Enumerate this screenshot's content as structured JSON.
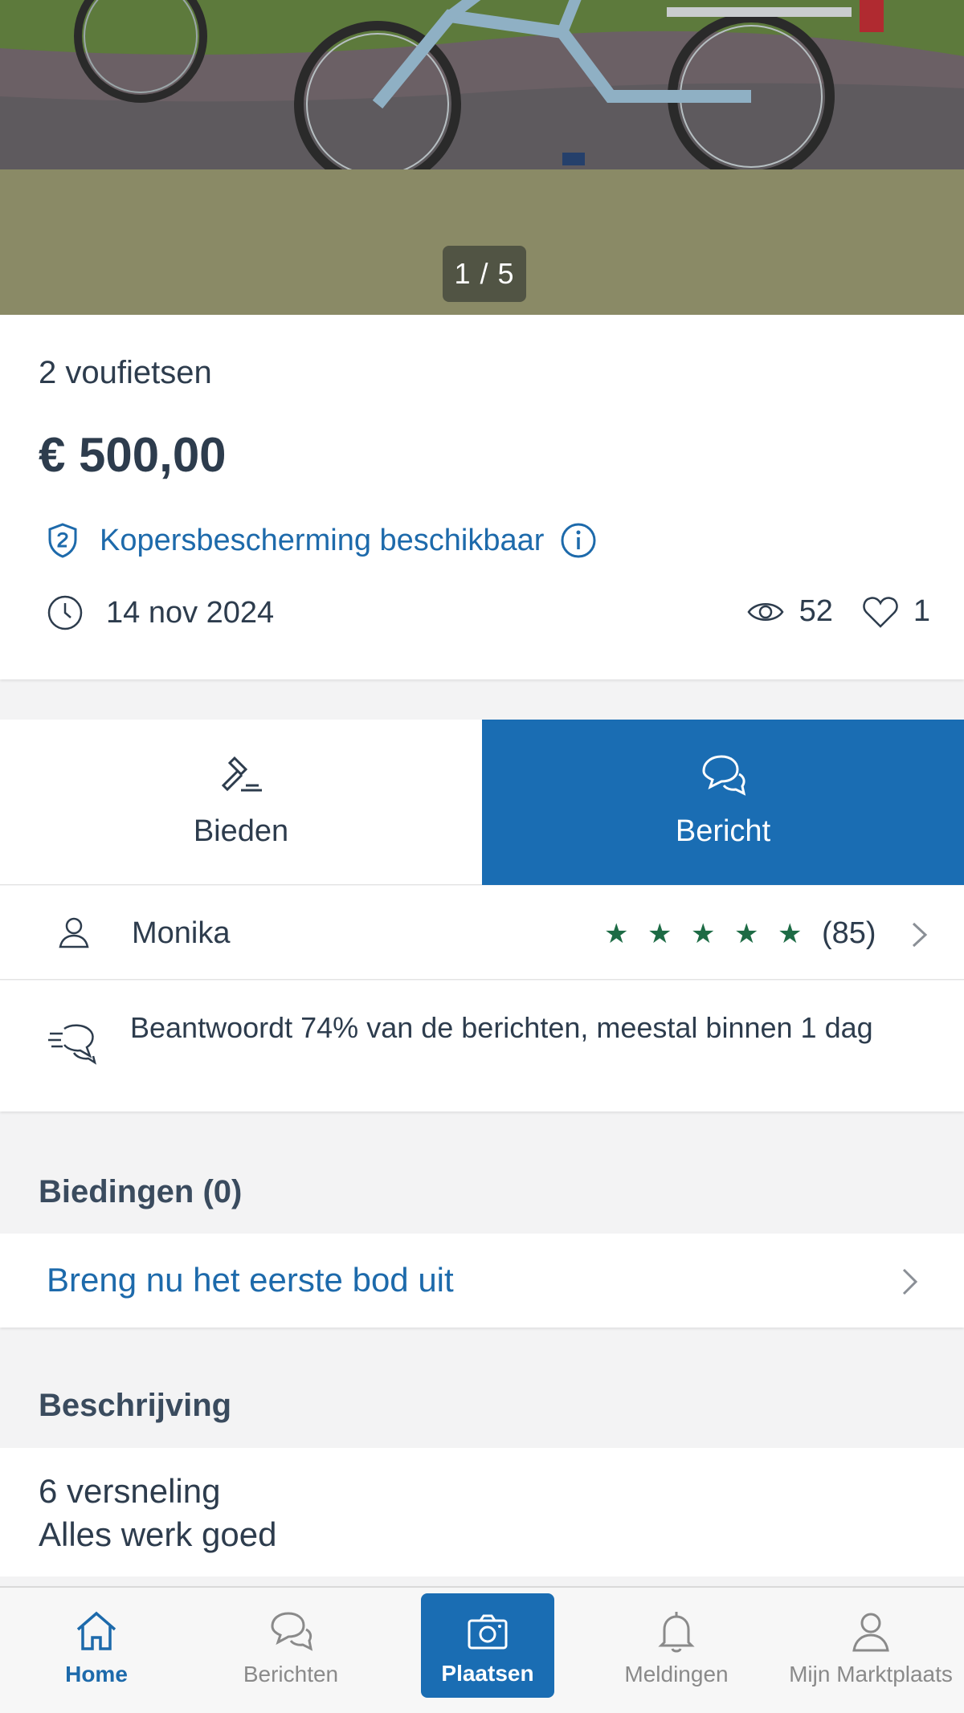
{
  "photo": {
    "counter": "1 / 5"
  },
  "listing": {
    "title": "2 voufietsen",
    "price": "€ 500,00",
    "protection": "Kopersbescherming beschikbaar",
    "date": "14 nov 2024",
    "views": "52",
    "favorites": "1"
  },
  "actions": {
    "bid_label": "Bieden",
    "message_label": "Bericht"
  },
  "seller": {
    "name": "Monika",
    "rating": 5,
    "reviews": "(85)",
    "response": "Beantwoordt 74% van de berichten, meestal binnen 1 dag"
  },
  "bids": {
    "title": "Biedingen (0)",
    "cta": "Breng nu het eerste bod uit"
  },
  "description": {
    "title": "Beschrijving",
    "line1": "6 versneling",
    "line2": "Alles werk goed"
  },
  "nav": {
    "home": "Home",
    "berichten": "Berichten",
    "plaatsen": "Plaatsen",
    "meldingen": "Meldingen",
    "mijn": "Mijn Marktplaats"
  },
  "colors": {
    "accent": "#1a6db3",
    "link": "#1d6aab",
    "star": "#1d6b45",
    "photo_bg": "#8a8a66"
  }
}
